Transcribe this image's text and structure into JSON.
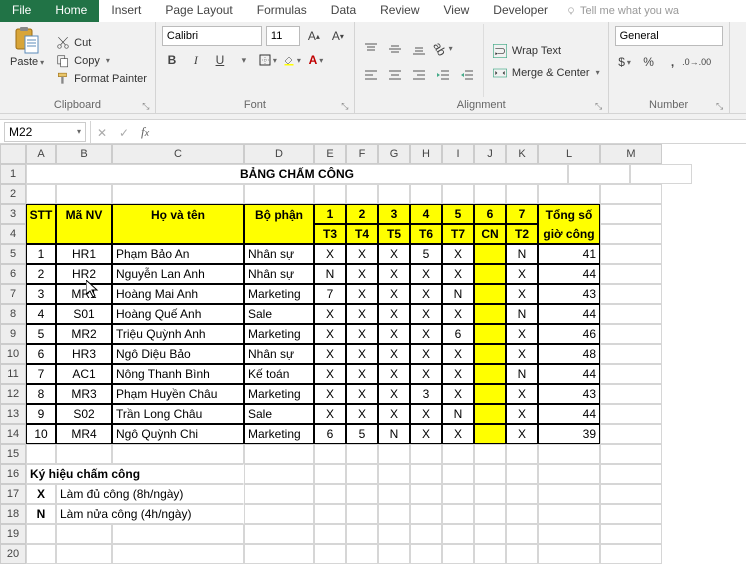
{
  "menu": {
    "file": "File",
    "home": "Home",
    "insert": "Insert",
    "page_layout": "Page Layout",
    "formulas": "Formulas",
    "data": "Data",
    "review": "Review",
    "view": "View",
    "developer": "Developer",
    "tellme": "Tell me what you wa"
  },
  "ribbon": {
    "clipboard": {
      "label": "Clipboard",
      "paste": "Paste",
      "cut": "Cut",
      "copy": "Copy",
      "format_painter": "Format Painter"
    },
    "font": {
      "label": "Font",
      "name": "Calibri",
      "size": "11"
    },
    "alignment": {
      "label": "Alignment",
      "wrap": "Wrap Text",
      "merge": "Merge & Center"
    },
    "number": {
      "label": "Number",
      "format": "General"
    }
  },
  "namebox": "M22",
  "columns": [
    "A",
    "B",
    "C",
    "D",
    "E",
    "F",
    "G",
    "H",
    "I",
    "J",
    "K",
    "L",
    "M"
  ],
  "title": "BẢNG CHẤM CÔNG",
  "headers": {
    "stt": "STT",
    "manv": "Mã NV",
    "hovaten": "Họ và tên",
    "bophan": "Bộ phận",
    "d1": "1",
    "d2": "2",
    "d3": "3",
    "d4": "4",
    "d5": "5",
    "d6": "6",
    "d7": "7",
    "t1": "T3",
    "t2": "T4",
    "t3": "T5",
    "t4": "T6",
    "t5": "T7",
    "t6": "CN",
    "t7": "T2",
    "tong": "Tổng số",
    "giocong": "giờ công"
  },
  "rows": [
    {
      "stt": "1",
      "ma": "HR1",
      "ten": "Phạm Bảo An",
      "bp": "Nhân sự",
      "d": [
        "X",
        "X",
        "X",
        "5",
        "X",
        "",
        "N"
      ],
      "tong": "41"
    },
    {
      "stt": "2",
      "ma": "HR2",
      "ten": "Nguyễn Lan Anh",
      "bp": "Nhân sự",
      "d": [
        "N",
        "X",
        "X",
        "X",
        "X",
        "",
        "X"
      ],
      "tong": "44"
    },
    {
      "stt": "3",
      "ma": "MR1",
      "ten": "Hoàng Mai Anh",
      "bp": "Marketing",
      "d": [
        "7",
        "X",
        "X",
        "X",
        "N",
        "",
        "X"
      ],
      "tong": "43"
    },
    {
      "stt": "4",
      "ma": "S01",
      "ten": "Hoàng Quế Anh",
      "bp": "Sale",
      "d": [
        "X",
        "X",
        "X",
        "X",
        "X",
        "",
        "N"
      ],
      "tong": "44"
    },
    {
      "stt": "5",
      "ma": "MR2",
      "ten": "Triệu Quỳnh Anh",
      "bp": "Marketing",
      "d": [
        "X",
        "X",
        "X",
        "X",
        "6",
        "",
        "X"
      ],
      "tong": "46"
    },
    {
      "stt": "6",
      "ma": "HR3",
      "ten": "Ngô Diệu Bảo",
      "bp": "Nhân sự",
      "d": [
        "X",
        "X",
        "X",
        "X",
        "X",
        "",
        "X"
      ],
      "tong": "48"
    },
    {
      "stt": "7",
      "ma": "AC1",
      "ten": "Nông Thanh Bình",
      "bp": "Kế toán",
      "d": [
        "X",
        "X",
        "X",
        "X",
        "X",
        "",
        "N"
      ],
      "tong": "44"
    },
    {
      "stt": "8",
      "ma": "MR3",
      "ten": "Phạm Huyền Châu",
      "bp": "Marketing",
      "d": [
        "X",
        "X",
        "X",
        "3",
        "X",
        "",
        "X"
      ],
      "tong": "43"
    },
    {
      "stt": "9",
      "ma": "S02",
      "ten": "Trần Long Châu",
      "bp": "Sale",
      "d": [
        "X",
        "X",
        "X",
        "X",
        "N",
        "",
        "X"
      ],
      "tong": "44"
    },
    {
      "stt": "10",
      "ma": "MR4",
      "ten": "Ngô Quỳnh Chi",
      "bp": "Marketing",
      "d": [
        "6",
        "5",
        "N",
        "X",
        "X",
        "",
        "X"
      ],
      "tong": "39"
    }
  ],
  "legend": {
    "title": "Ký hiệu chấm công",
    "x_sym": "X",
    "x_txt": "Làm đủ công (8h/ngày)",
    "n_sym": "N",
    "n_txt": "Làm nửa công (4h/ngày)"
  }
}
